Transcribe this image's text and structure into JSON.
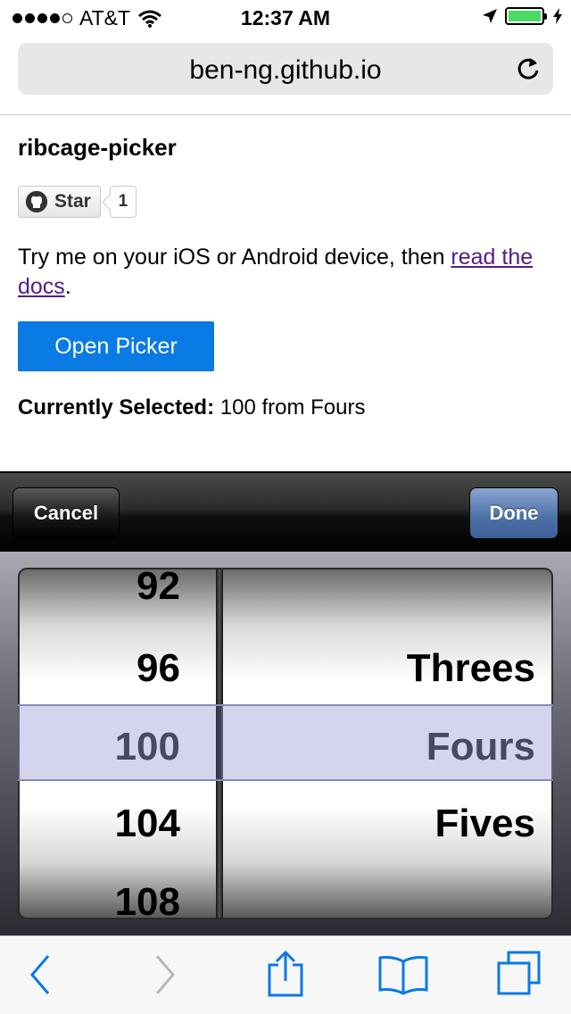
{
  "status_bar": {
    "carrier": "AT&T",
    "time": "12:37 AM",
    "battery_color": "#4cd964"
  },
  "browser": {
    "url": "ben-ng.github.io"
  },
  "page": {
    "title": "ribcage-picker",
    "star_label": "Star",
    "star_count": "1",
    "desc_text": "Try me on your iOS or Android device, then ",
    "desc_link": "read the docs",
    "desc_end": ".",
    "open_button": "Open Picker",
    "selected_label": "Currently Selected:",
    "selected_value": "100 from Fours",
    "button_color": "#0a7ae5"
  },
  "picker": {
    "cancel_label": "Cancel",
    "done_label": "Done",
    "numbers": [
      "92",
      "96",
      "100",
      "104",
      "108"
    ],
    "groups": [
      "Threes",
      "Fours",
      "Fives"
    ],
    "selected_number": "100",
    "selected_group": "Fours"
  },
  "toolbar_icons": [
    "back-icon",
    "forward-icon",
    "share-icon",
    "bookmarks-icon",
    "tabs-icon"
  ]
}
